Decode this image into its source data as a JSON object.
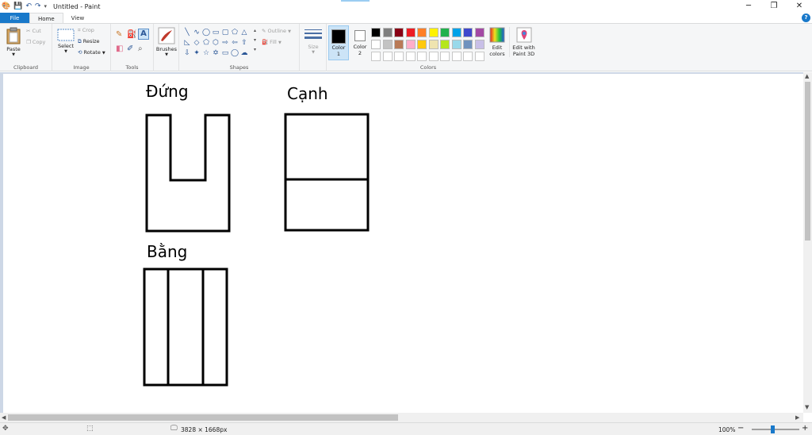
{
  "window": {
    "title": "Untitled - Paint",
    "minimize": "─",
    "restore": "❐",
    "close": "✕"
  },
  "tabs": {
    "file": "File",
    "home": "Home",
    "view": "View",
    "help": "?"
  },
  "ribbon": {
    "clipboard": {
      "label": "Clipboard",
      "paste": "Paste",
      "cut": "Cut",
      "copy": "Copy"
    },
    "image": {
      "label": "Image",
      "select": "Select",
      "crop": "Crop",
      "resize": "Resize",
      "rotate": "Rotate"
    },
    "tools": {
      "label": "Tools",
      "text_glyph": "A"
    },
    "brushes": {
      "label": "Brushes"
    },
    "shapes": {
      "label": "Shapes",
      "outline": "Outline",
      "fill": "Fill"
    },
    "size": {
      "label": "Size"
    },
    "color1": {
      "label": "Color",
      "num": "1",
      "value": "#000000"
    },
    "color2": {
      "label": "Color",
      "num": "2",
      "value": "#ffffff"
    },
    "colors": {
      "label": "Colors",
      "palette_row1": [
        "#000000",
        "#7f7f7f",
        "#880015",
        "#ed1c24",
        "#ff7f27",
        "#fff200",
        "#22b14c",
        "#00a2e8",
        "#3f48cc",
        "#a349a4"
      ],
      "palette_row2": [
        "#ffffff",
        "#c3c3c3",
        "#b97a57",
        "#ffaec9",
        "#ffc90e",
        "#efe4b0",
        "#b5e61d",
        "#99d9ea",
        "#7092be",
        "#c8bfe7"
      ]
    },
    "edit_colors": {
      "line1": "Edit",
      "line2": "colors"
    },
    "paint3d": {
      "line1": "Edit with",
      "line2": "Paint 3D"
    }
  },
  "canvas": {
    "labels": {
      "front": "Đứng",
      "side": "Cạnh",
      "top": "Bằng"
    }
  },
  "status": {
    "dimensions": "3828 × 1668px",
    "zoom": "100%",
    "zoom_out": "−",
    "zoom_in": "+"
  }
}
